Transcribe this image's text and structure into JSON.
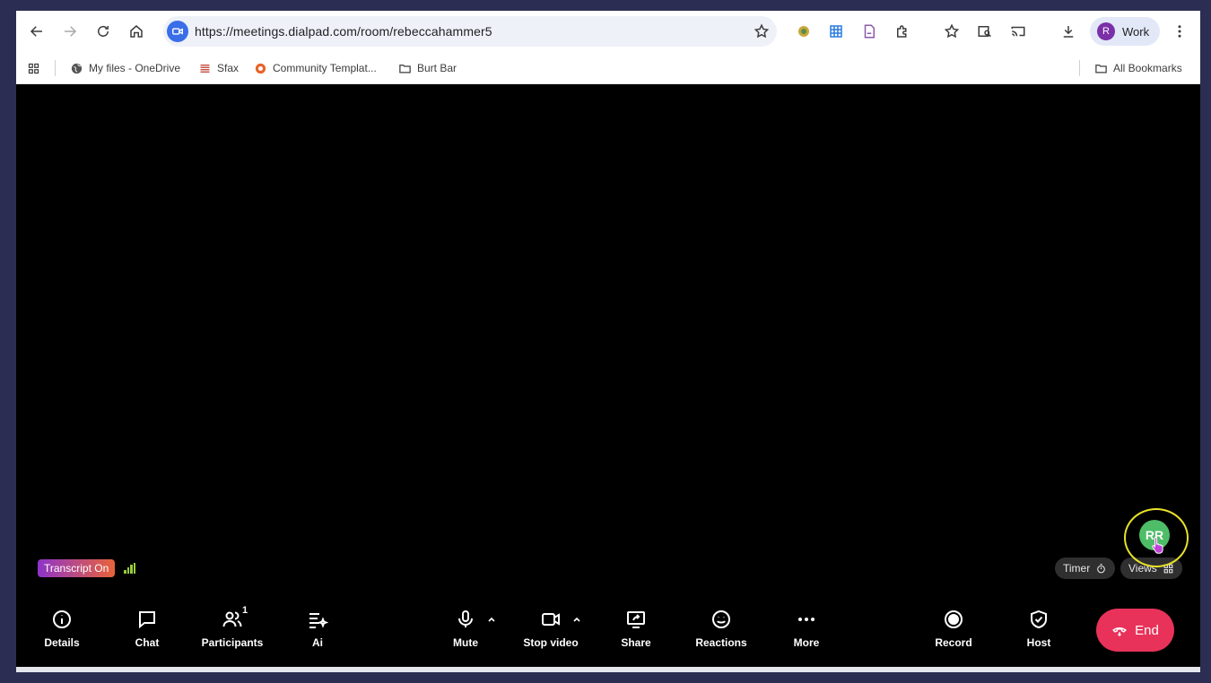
{
  "browser": {
    "url": "https://meetings.dialpad.com/room/rebeccahammer5",
    "profile": {
      "initial": "R",
      "label": "Work"
    },
    "bookmarks": [
      {
        "label": "My files - OneDrive"
      },
      {
        "label": "Sfax"
      },
      {
        "label": "Community Templat..."
      },
      {
        "label": "Burt Bar"
      }
    ],
    "all_bookmarks": "All Bookmarks"
  },
  "meeting": {
    "transcript_badge": "Transcript On",
    "timer_label": "Timer",
    "views_label": "Views",
    "participant_initials": "RR",
    "controls": {
      "details": "Details",
      "chat": "Chat",
      "participants": "Participants",
      "participants_count": "1",
      "ai": "Ai",
      "mute": "Mute",
      "stop_video": "Stop video",
      "share": "Share",
      "reactions": "Reactions",
      "more": "More",
      "record": "Record",
      "host": "Host",
      "end": "End"
    }
  },
  "colors": {
    "end_button": "#e8325a",
    "avatar": "#4ebd67",
    "highlight_ring": "#e8e12a",
    "profile_avatar": "#7b2fa8",
    "site_icon": "#3a6ee8"
  }
}
